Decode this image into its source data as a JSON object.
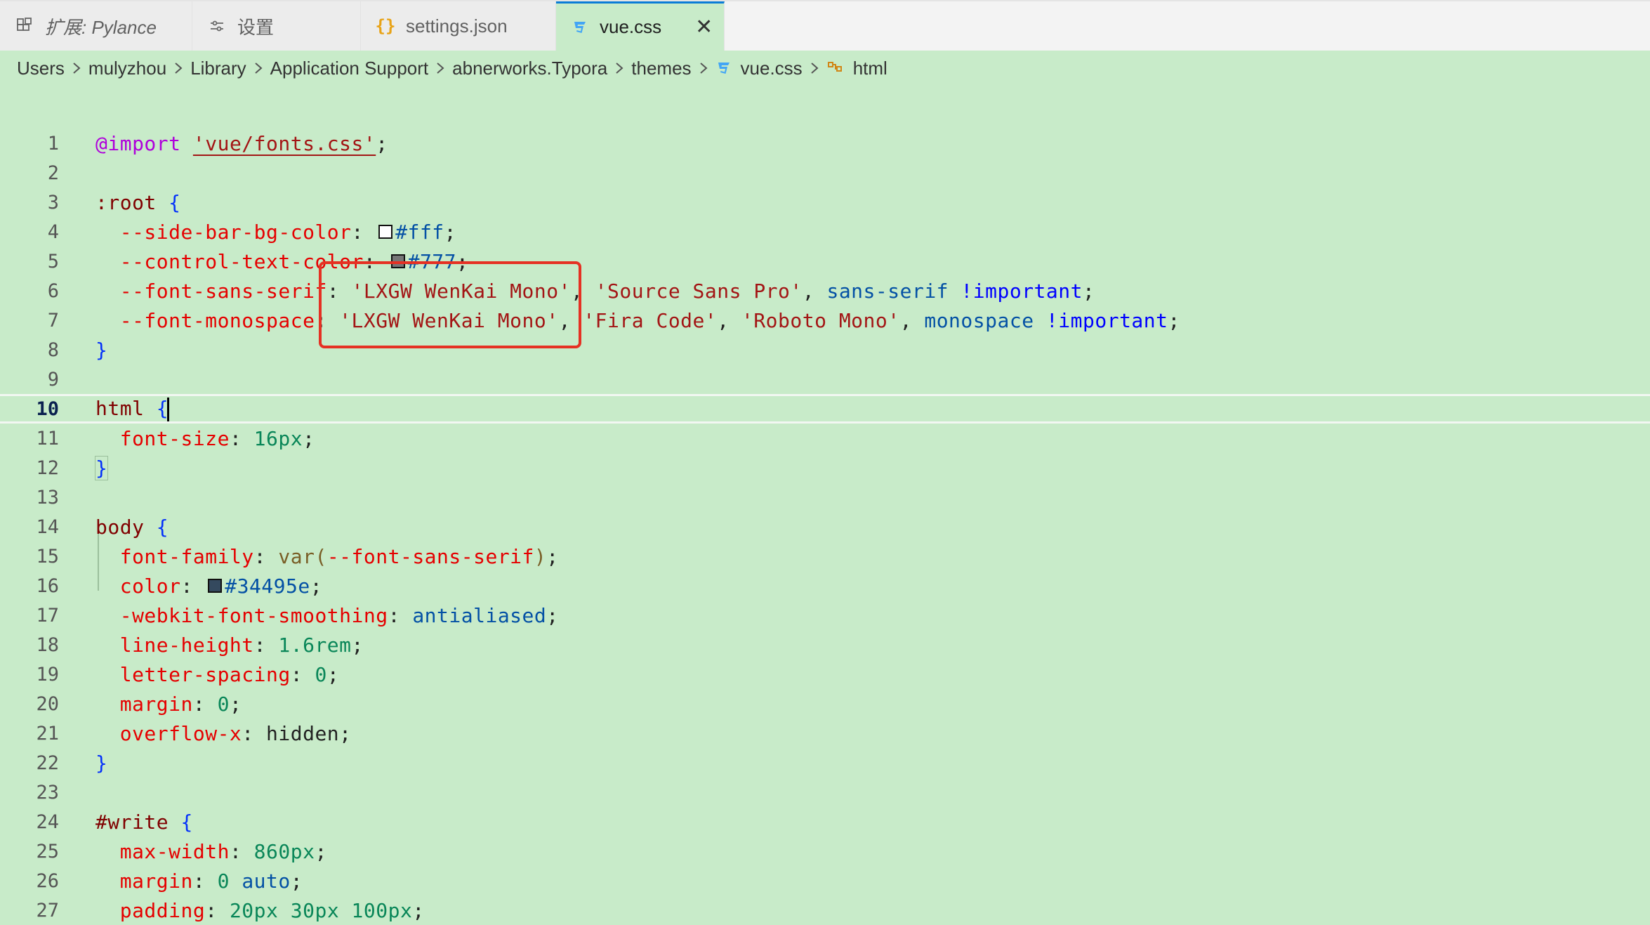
{
  "tabs": [
    {
      "label": "扩展: Pylance",
      "icon": "extensions-icon",
      "active": false
    },
    {
      "label": "设置",
      "icon": "settings-sliders-icon",
      "active": false
    },
    {
      "label": "settings.json",
      "icon": "json-braces-icon",
      "active": false
    },
    {
      "label": "vue.css",
      "icon": "css-file-icon",
      "active": true
    }
  ],
  "breadcrumb": [
    "Users",
    "mulyzhou",
    "Library",
    "Application Support",
    "abnerworks.Typora",
    "themes",
    "vue.css",
    "html"
  ],
  "editor": {
    "current_line": 10,
    "line_numbers": [
      "1",
      "2",
      "3",
      "4",
      "5",
      "6",
      "7",
      "8",
      "9",
      "10",
      "11",
      "12",
      "13",
      "14",
      "15",
      "16",
      "17",
      "18",
      "19",
      "20",
      "21",
      "22",
      "23",
      "24",
      "25",
      "26",
      "27"
    ],
    "code": {
      "l1": {
        "at": "@import",
        "str": "'vue/fonts.css'",
        "end": ";"
      },
      "l3": {
        "sel": ":root",
        "brace": "{"
      },
      "l4": {
        "prop": "--side-bar-bg-color",
        "colon": ": ",
        "hex": "#fff",
        "end": ";"
      },
      "l5": {
        "prop": "--control-text-color",
        "colon": ": ",
        "hex": "#777",
        "end": ";"
      },
      "l6": {
        "prop": "--font-sans-serif",
        "colon": ": ",
        "s1": "'LXGW WenKai Mono'",
        "c1": ", ",
        "s2": "'Source Sans Pro'",
        "c2": ", ",
        "kw": "sans-serif",
        "imp": "!important",
        "end": ";"
      },
      "l7": {
        "prop": "--font-monospace",
        "colon": ": ",
        "s1": "'LXGW WenKai Mono'",
        "c1": ", ",
        "s2": "'Fira Code'",
        "c2": ", ",
        "s3": "'Roboto Mono'",
        "c3": ", ",
        "kw": "monospace",
        "imp": "!important",
        "end": ";"
      },
      "l8": {
        "brace": "}"
      },
      "l10": {
        "sel": "html",
        "brace": "{"
      },
      "l11": {
        "prop": "font-size",
        "colon": ": ",
        "num": "16px",
        "end": ";"
      },
      "l12": {
        "brace": "}"
      },
      "l14": {
        "sel": "body",
        "brace": "{"
      },
      "l15": {
        "prop": "font-family",
        "colon": ": ",
        "fn": "var(",
        "arg": "--font-sans-serif",
        "close": ")",
        "end": ";"
      },
      "l16": {
        "prop": "color",
        "colon": ": ",
        "hex": "#34495e",
        "end": ";"
      },
      "l17": {
        "prop": "-webkit-font-smoothing",
        "colon": ": ",
        "kw": "antialiased",
        "end": ";"
      },
      "l18": {
        "prop": "line-height",
        "colon": ": ",
        "num": "1.6rem",
        "end": ";"
      },
      "l19": {
        "prop": "letter-spacing",
        "colon": ": ",
        "num": "0",
        "end": ";"
      },
      "l20": {
        "prop": "margin",
        "colon": ": ",
        "num": "0",
        "end": ";"
      },
      "l21": {
        "prop": "overflow-x",
        "colon": ": ",
        "kw": "hidden",
        "end": ";"
      },
      "l22": {
        "brace": "}"
      },
      "l24": {
        "sel": "#write",
        "brace": "{"
      },
      "l25": {
        "prop": "max-width",
        "colon": ": ",
        "num": "860px",
        "end": ";"
      },
      "l26": {
        "prop": "margin",
        "colon": ": ",
        "num": "0",
        "kw": "auto",
        "end": ";"
      },
      "l27": {
        "prop": "padding",
        "colon": ": ",
        "num": "20px 30px 100px",
        "end": ";"
      }
    }
  },
  "colors": {
    "editor_bg": "#c8ebc9",
    "annotation_box": "#e53123",
    "swatch_fff": "#ffffff",
    "swatch_777": "#777777",
    "swatch_34495e": "#34495e"
  }
}
